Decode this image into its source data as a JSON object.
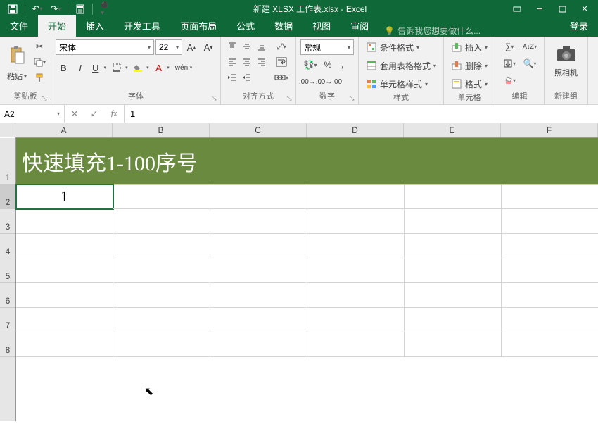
{
  "title": "新建 XLSX 工作表.xlsx - Excel",
  "tabs": {
    "file": "文件",
    "home": "开始",
    "insert": "插入",
    "dev": "开发工具",
    "layout": "页面布局",
    "formulas": "公式",
    "data": "数据",
    "view": "视图",
    "review": "审阅"
  },
  "tellme": "告诉我您想要做什么...",
  "login": "登录",
  "ribbon": {
    "clipboard": {
      "paste": "粘贴",
      "name": "剪贴板"
    },
    "font": {
      "family": "宋体",
      "size": "22",
      "name": "字体"
    },
    "alignment": {
      "name": "对齐方式"
    },
    "number": {
      "format": "常规",
      "name": "数字"
    },
    "styles": {
      "cond": "条件格式",
      "table": "套用表格格式",
      "cell": "单元格样式",
      "name": "样式"
    },
    "cells": {
      "insert": "插入",
      "delete": "删除",
      "format": "格式",
      "name": "单元格"
    },
    "editing": {
      "name": "编辑"
    },
    "camera": {
      "label": "照相机",
      "name": "新建组"
    }
  },
  "name_box": "A2",
  "formula_value": "1",
  "col_headers": [
    "A",
    "B",
    "C",
    "D",
    "E",
    "F"
  ],
  "row_headers": [
    "1",
    "2",
    "3",
    "4",
    "5",
    "6",
    "7",
    "8"
  ],
  "merged_header_text": "快速填充1-100序号",
  "active_cell_value": "1"
}
